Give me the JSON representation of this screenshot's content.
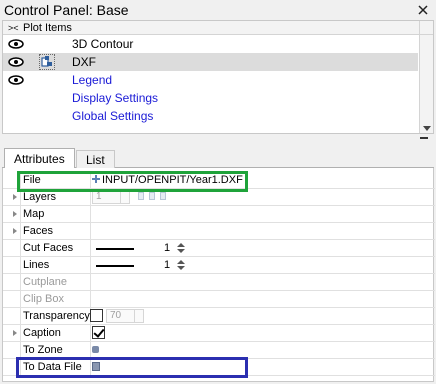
{
  "window": {
    "title": "Control Panel: Base"
  },
  "plot_items": {
    "header": "Plot Items",
    "items": [
      {
        "label": "3D Contour",
        "visible_icon": "eye-icon",
        "is_link": false
      },
      {
        "label": "DXF",
        "visible_icon": "eye-icon",
        "is_link": false,
        "selected": true,
        "type_icon": "dxf-icon"
      },
      {
        "label": "Legend",
        "visible_icon": "eye-icon",
        "is_link": true
      },
      {
        "label": "Display Settings",
        "is_link": true
      },
      {
        "label": "Global Settings",
        "is_link": true
      }
    ]
  },
  "tabs": [
    "Attributes",
    "List"
  ],
  "active_tab": "Attributes",
  "attributes": {
    "file": {
      "label": "File",
      "value": "INPUT/OPENPIT/Year1.DXF"
    },
    "layers": {
      "label": "Layers",
      "value": "1"
    },
    "map": {
      "label": "Map"
    },
    "faces": {
      "label": "Faces"
    },
    "cut_faces": {
      "label": "Cut Faces",
      "value": "1"
    },
    "lines": {
      "label": "Lines",
      "value": "1"
    },
    "cutplane": {
      "label": "Cutplane"
    },
    "clip_box": {
      "label": "Clip Box"
    },
    "transparency": {
      "label": "Transparency",
      "value": "70",
      "checked": false
    },
    "caption": {
      "label": "Caption",
      "checked": true
    },
    "to_zone": {
      "label": "To Zone"
    },
    "to_data_file": {
      "label": "To Data File"
    }
  },
  "highlight_colors": {
    "file_box": "#1fa33a",
    "data_file_box": "#2b2fb0"
  }
}
